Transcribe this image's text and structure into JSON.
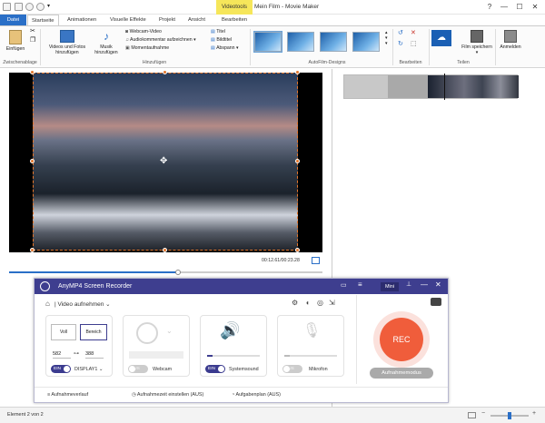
{
  "window": {
    "context_tab": "Videotools",
    "title": "Mein Film - Movie Maker",
    "controls": {
      "help": "?",
      "minimize": "—",
      "maximize": "☐",
      "close": "✕"
    }
  },
  "tabs": [
    "Datei",
    "Startseite",
    "Animationen",
    "Visuelle Effekte",
    "Projekt",
    "Ansicht",
    "Bearbeiten"
  ],
  "ribbon": {
    "clipboard": {
      "paste": "Einfügen",
      "group": "Zwischenablage"
    },
    "add": {
      "videos_photos": "Videos und Fotos hinzufügen",
      "music": "Musik hinzufügen",
      "webcam": "Webcam-Video",
      "narration": "Audiokommentar aufzeichnen",
      "snapshot": "Momentaufnahme",
      "title": "Titel",
      "caption": "Bildtitel",
      "credits": "Abspann",
      "group": "Hinzufügen"
    },
    "themes": {
      "group": "AutoFilm-Designs"
    },
    "edit": {
      "group": "Bearbeiten"
    },
    "share": {
      "save_movie": "Film speichern",
      "signin": "Anmelden",
      "group": "Teilen"
    }
  },
  "player": {
    "time": "00:12.61/00:23.28",
    "progress": 0.54
  },
  "recorder": {
    "title": "AnyMP4 Screen Recorder",
    "mini_label": "Mini",
    "mode_label": "Video aufnehmen",
    "display": {
      "full": "Voll",
      "region": "Bereich",
      "width": "582",
      "height": "388",
      "toggle": "EIN",
      "source": "DISPLAY1"
    },
    "webcam": {
      "toggle": "AUS",
      "label": "Webcam"
    },
    "system_sound": {
      "toggle": "EIN",
      "label": "Systemsound",
      "level": 0.1
    },
    "microphone": {
      "toggle": "AUS",
      "label": "Mikrofon",
      "level": 0.1
    },
    "rec_label": "REC",
    "record_mode": "Aufnahmemodus",
    "footer": {
      "history": "Aufnahmeverlauf",
      "schedule": "Aufnahmezeit einstellen (AUS)",
      "tasks": "Aufgabenplan (AUS)"
    }
  },
  "status": {
    "element": "Element 2 von 2",
    "zoom_level": 0.5
  },
  "colors": {
    "accent": "#2a6fc7",
    "recorder_bar": "#3e3e8f",
    "rec_button": "#f05d3b",
    "handles": "#e5762b",
    "context_tab": "#f6e65a"
  }
}
